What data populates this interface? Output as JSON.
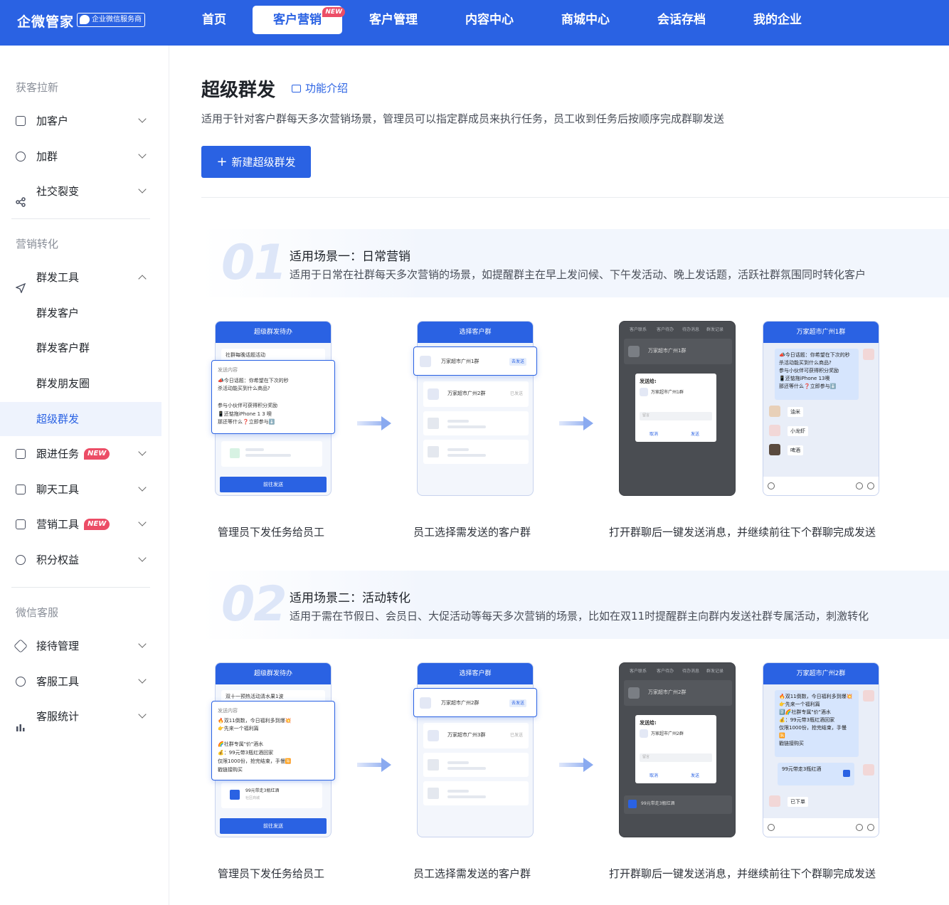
{
  "brand": {
    "name": "企微管家",
    "badge": "企业微信服务商"
  },
  "nav": [
    {
      "label": "首页",
      "active": false
    },
    {
      "label": "客户营销",
      "active": true,
      "tag": "NEW"
    },
    {
      "label": "客户管理",
      "active": false
    },
    {
      "label": "内容中心",
      "active": false
    },
    {
      "label": "商城中心",
      "active": false
    },
    {
      "label": "会话存档",
      "active": false
    },
    {
      "label": "我的企业",
      "active": false
    }
  ],
  "sidebar": {
    "groups": [
      "获客拉新",
      "营销转化",
      "微信客服"
    ],
    "items": [
      {
        "label": "加客户",
        "icon": "grid-icon"
      },
      {
        "label": "加群",
        "icon": "user-add-icon"
      },
      {
        "label": "社交裂变",
        "icon": "share-icon"
      },
      {
        "label": "群发工具",
        "icon": "send-icon"
      },
      {
        "label": "群发客户"
      },
      {
        "label": "群发客户群"
      },
      {
        "label": "群发朋友圈"
      },
      {
        "label": "超级群发"
      },
      {
        "label": "跟进任务",
        "icon": "task-icon",
        "tag": "NEW"
      },
      {
        "label": "聊天工具",
        "icon": "chat-icon"
      },
      {
        "label": "营销工具",
        "icon": "chart-icon",
        "tag": "NEW"
      },
      {
        "label": "积分权益",
        "icon": "coins-icon"
      },
      {
        "label": "接待管理",
        "icon": "diamond-icon"
      },
      {
        "label": "客服工具",
        "icon": "headset-icon"
      },
      {
        "label": "客服统计",
        "icon": "bar-chart-icon"
      }
    ]
  },
  "page": {
    "title": "超级群发",
    "intro_link": "功能介绍",
    "description": "适用于针对客户群每天多次营销场景，管理员可以指定群成员来执行任务，员工收到任务后按顺序完成群聊发送",
    "new_button": "新建超级群发"
  },
  "scenes": [
    {
      "num": "01",
      "title": "适用场景一：日常营销",
      "desc": "适用于日常在社群每天多次营销的场景，如提醒群主在早上发问候、下午发活动、晚上发话题，活跃社群氛围同时转化客户",
      "captions": [
        "管理员下发任务给员工",
        "员工选择需发送的客户群",
        "打开群聊后一键发送消息，并继续前往下个群聊完成发送"
      ],
      "phone1": {
        "header": "超级群发待办",
        "task": "社群每晚话题活动",
        "send_label": "发送内容",
        "lines": [
          "📣今日话题：你希望在下次的秒",
          "杀活动能买到什么商品?",
          "",
          "参与小伙伴可获得积分奖励",
          "📱还惦拖iPhone  1 3 噢",
          "那还等什么❓立即参与⬇️"
        ],
        "btn": "前往发送"
      },
      "phone2": {
        "header": "选择客户群",
        "g1": "万家超市广州1群",
        "g1_btn": "去发送",
        "g2": "万家超市广州2群",
        "g2_status": "已发送"
      },
      "phone3": {
        "tabs": [
          "客户联系",
          "客户待办",
          "待办消息",
          "群发记录"
        ],
        "group": "万家超市广州1群",
        "dialog_title": "发送给:",
        "dialog_group": "万家超市广州1群",
        "cancel": "取消",
        "send": "发送",
        "placeholder": "留言"
      },
      "phone4": {
        "header": "万家超市广州1群",
        "bubble": [
          "📣今日话题：你希望在下次的秒",
          "杀活动能买到什么商品?",
          "参与小伙伴可获得积分奖励",
          "📱还惦拖iPhone 13噢",
          "那还等什么❓立即参与⬇️"
        ],
        "replies": [
          "油米",
          "小龙虾",
          "啤酒"
        ]
      }
    },
    {
      "num": "02",
      "title": "适用场景二：活动转化",
      "desc": "适用于需在节假日、会员日、大促活动等每天多次营销的场景，比如在双11时提醒群主向群内发送社群专属活动，刺激转化",
      "captions": [
        "管理员下发任务给员工",
        "员工选择需发送的客户群",
        "打开群聊后一键发送消息，并继续前往下个群聊完成发送"
      ],
      "phone1": {
        "header": "超级群发待办",
        "task": "双十一预热活动清水果1波",
        "send_label": "发送内容",
        "lines": [
          "🔥双11倒数，今日福利多到爆💥",
          "👉先来一个福利篇",
          "",
          "🌈社群专属\"价\"酒水",
          "💰：99元带3瓶红酒回家",
          "仅限1000份，抢完结束，手慢🈚",
          "戳链接购买"
        ],
        "link": "99元带走3瓶红酒",
        "link_sub": "社区商城",
        "btn": "前往发送"
      },
      "phone2": {
        "header": "选择客户群",
        "g1": "万家超市广州2群",
        "g1_btn": "去发送",
        "g2": "万家超市广州3群",
        "g2_status": "已发送"
      },
      "phone3": {
        "tabs": [
          "客户联系",
          "客户待办",
          "待办消息",
          "群发记录"
        ],
        "group": "万家超市广州2群",
        "dialog_title": "发送给:",
        "dialog_group": "万家超市广州2群",
        "cancel": "取消",
        "send": "发送",
        "placeholder": "留言",
        "bottom_link": "99元带走3瓶红酒"
      },
      "phone4": {
        "header": "万家超市广州2群",
        "bubble": [
          "🔥双11倒数，今日福利多到爆💥",
          "👉先来一个福利篇",
          "2️⃣🌈社群专属\"价\"酒水",
          "💰：99元带3瓶红酒回家",
          "仅限1000份，抢完结束，手慢",
          "🈚",
          "戳链接购买"
        ],
        "link": "99元带走3瓶红酒",
        "replies": [
          "已下单"
        ]
      }
    }
  ]
}
